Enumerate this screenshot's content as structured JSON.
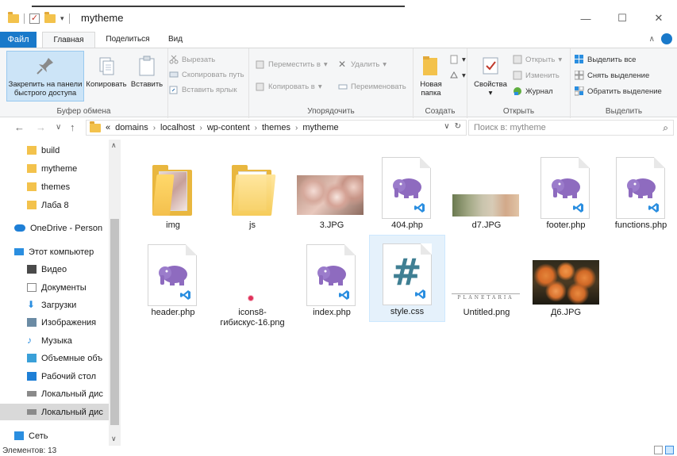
{
  "window": {
    "title": "mytheme",
    "minimize": "—",
    "maximize": "☐",
    "close": "✕"
  },
  "ribbon_tabs": [
    "Файл",
    "Главная",
    "Поделиться",
    "Вид"
  ],
  "ribbon": {
    "clipboard": {
      "label": "Буфер обмена",
      "pin": "Закрепить на панели быстрого доступа",
      "copy": "Копировать",
      "paste": "Вставить",
      "cut": "Вырезать",
      "copy_path": "Скопировать путь",
      "paste_shortcut": "Вставить ярлык"
    },
    "organize": {
      "label": "Упорядочить",
      "move_to": "Переместить в",
      "copy_to": "Копировать в",
      "delete": "Удалить",
      "rename": "Переименовать"
    },
    "new": {
      "label": "Создать",
      "new_folder": "Новая папка"
    },
    "open": {
      "label": "Открыть",
      "properties": "Свойства",
      "open": "Открыть",
      "edit": "Изменить",
      "history": "Журнал"
    },
    "select": {
      "label": "Выделить",
      "select_all": "Выделить все",
      "select_none": "Снять выделение",
      "invert": "Обратить выделение"
    }
  },
  "address": {
    "prefix": "«",
    "path": [
      "domains",
      "localhost",
      "wp-content",
      "themes",
      "mytheme"
    ],
    "search_placeholder": "Поиск в: mytheme"
  },
  "nav": [
    {
      "label": "build",
      "icon": "folder-icon"
    },
    {
      "label": "mytheme",
      "icon": "folder-icon"
    },
    {
      "label": "themes",
      "icon": "folder-icon"
    },
    {
      "label": "Лаба 8",
      "icon": "folder-icon"
    },
    {
      "label": "OneDrive - Person",
      "icon": "onedrive-icon"
    },
    {
      "label": "Этот компьютер",
      "icon": "computer-icon"
    },
    {
      "label": "Видео",
      "icon": "video-icon"
    },
    {
      "label": "Документы",
      "icon": "documents-icon"
    },
    {
      "label": "Загрузки",
      "icon": "downloads-icon"
    },
    {
      "label": "Изображения",
      "icon": "pictures-icon"
    },
    {
      "label": "Музыка",
      "icon": "music-icon"
    },
    {
      "label": "Объемные объ",
      "icon": "3d-objects-icon"
    },
    {
      "label": "Рабочий стол",
      "icon": "desktop-icon"
    },
    {
      "label": "Локальный дис",
      "icon": "drive-icon"
    },
    {
      "label": "Локальный дис",
      "icon": "drive-icon"
    },
    {
      "label": "Сеть",
      "icon": "network-icon"
    }
  ],
  "files": [
    {
      "name": "img",
      "type": "folder"
    },
    {
      "name": "js",
      "type": "folder"
    },
    {
      "name": "3.JPG",
      "type": "photo"
    },
    {
      "name": "404.php",
      "type": "php"
    },
    {
      "name": "d7.JPG",
      "type": "photo"
    },
    {
      "name": "footer.php",
      "type": "php"
    },
    {
      "name": "functions.php",
      "type": "php"
    },
    {
      "name": "header.php",
      "type": "php"
    },
    {
      "name": "icons8-гибискус-16.png",
      "type": "png"
    },
    {
      "name": "index.php",
      "type": "php"
    },
    {
      "name": "style.css",
      "type": "css"
    },
    {
      "name": "Untitled.png",
      "type": "png"
    },
    {
      "name": "Д6.JPG",
      "type": "photo"
    }
  ],
  "untitled_thumb_text": "PLANETARIA",
  "status": {
    "items": "Элементов: 13"
  },
  "colors": {
    "accent": "#1979ca",
    "folder": "#f3c24c",
    "php_purple": "#8e6bbf",
    "css_teal": "#3f7f93",
    "vs_blue": "#2a8ee0"
  }
}
